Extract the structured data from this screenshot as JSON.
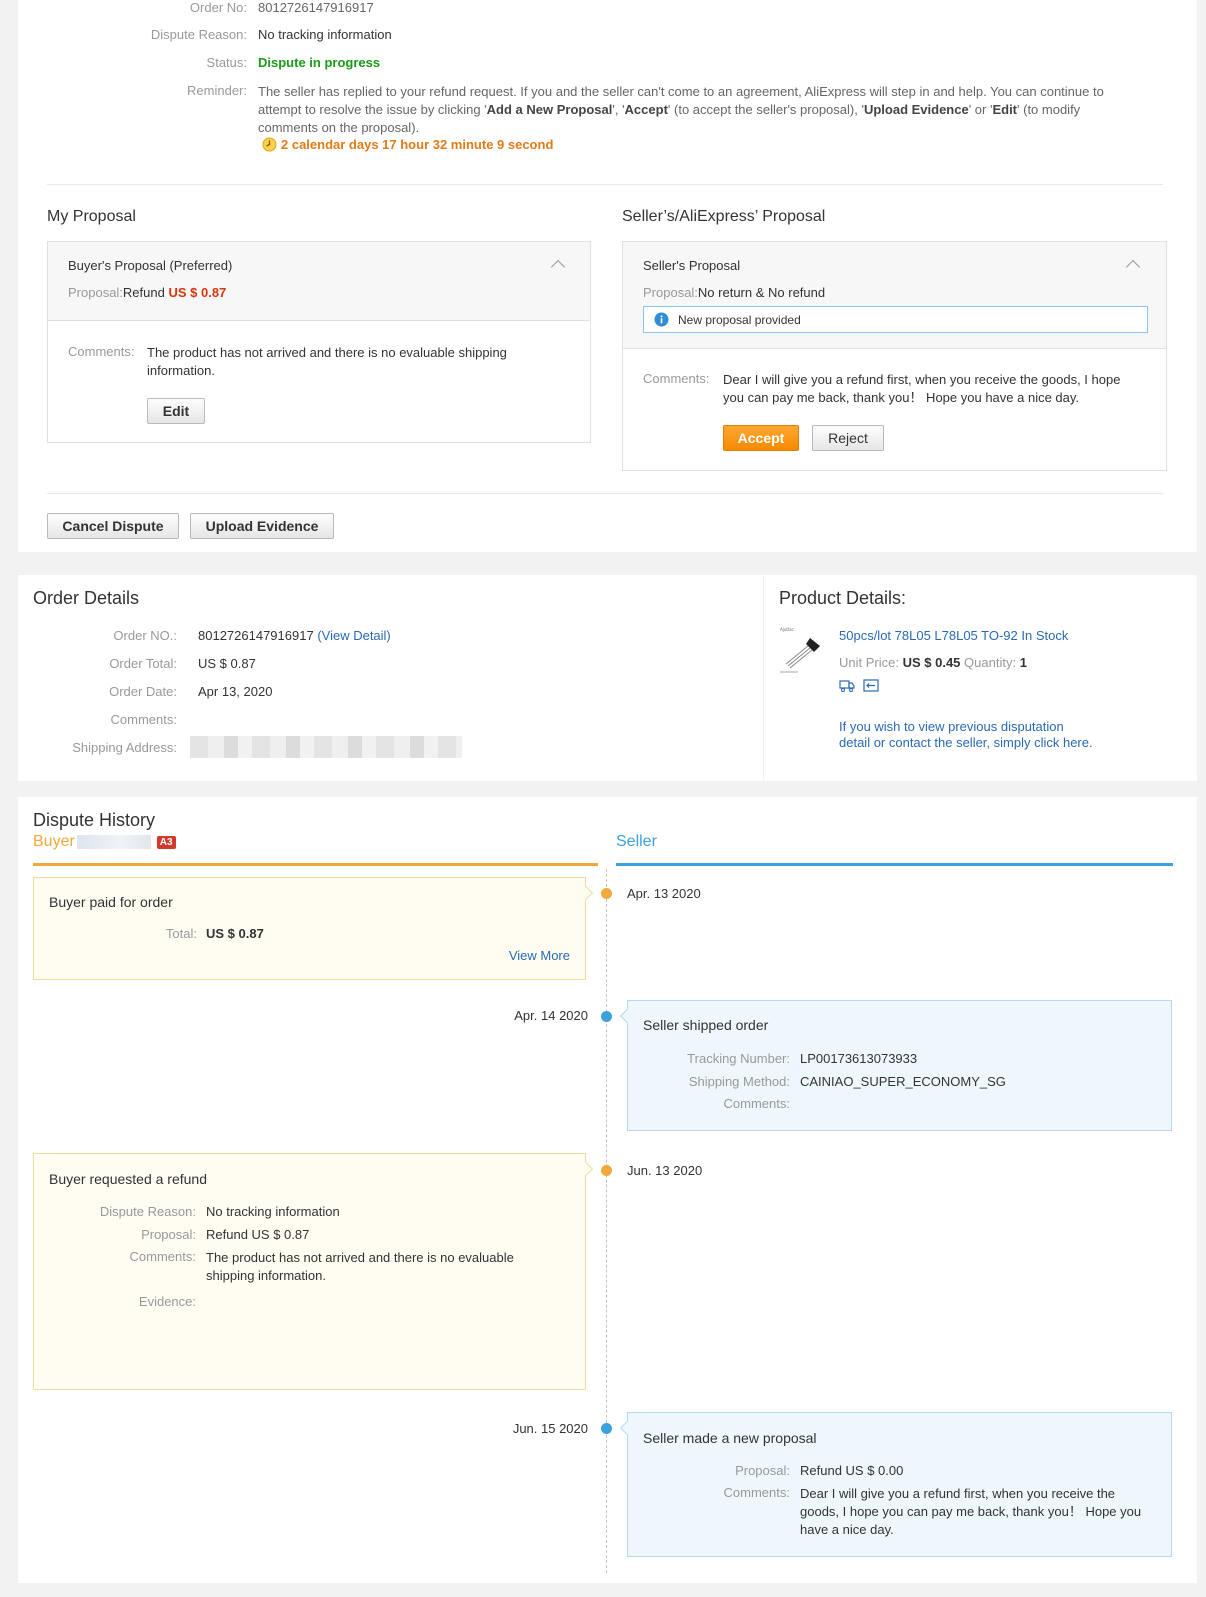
{
  "dispute": {
    "order_no_label": "Order No:",
    "order_no": "8012726147916917",
    "reason_label": "Dispute Reason:",
    "reason": "No tracking information",
    "status_label": "Status:",
    "status": "Dispute in progress",
    "reminder_label": "Reminder:",
    "reminder_text_1": "The seller has replied to your refund request. If you and the seller can't come to an agreement, AliExpress will step in and help. You can continue to",
    "reminder_text_2a": "attempt to resolve the issue by clicking '",
    "reminder_add": "Add a New Proposal",
    "reminder_text_2b": "', '",
    "reminder_accept": "Accept",
    "reminder_text_2c": "' (to accept the seller's proposal), '",
    "reminder_upload": "Upload Evidence",
    "reminder_text_2d": "' or '",
    "reminder_edit": "Edit",
    "reminder_text_2e": "' (to modify",
    "reminder_text_3": "comments on the proposal).",
    "countdown": "2 calendar days 17 hour 32 minute 9 second"
  },
  "my_proposal": {
    "heading": "My Proposal",
    "title": "Buyer's Proposal (Preferred)",
    "proposal_label": "Proposal:",
    "proposal_text": "Refund ",
    "proposal_amount": "US $ 0.87",
    "comments_label": "Comments:",
    "comments_1": "The product has not arrived and there is no evaluable shipping",
    "comments_2": "information.",
    "edit_label": "Edit"
  },
  "seller_proposal": {
    "heading": "Seller’s/AliExpress’ Proposal",
    "title": "Seller's Proposal",
    "proposal_label": "Proposal:",
    "proposal_text": "No return & No refund",
    "notice": "New proposal provided",
    "comments_label": "Comments:",
    "comments_1": "Dear I will give you a refund first, when you receive the goods, I hope",
    "comments_2": "you can pay me back, thank you！ Hope you have a nice day.",
    "accept_label": "Accept",
    "reject_label": "Reject"
  },
  "actions": {
    "cancel_label": "Cancel Dispute",
    "upload_label": "Upload Evidence"
  },
  "order_details": {
    "heading": "Order Details",
    "order_no_label": "Order NO.:",
    "order_no": "8012726147916917",
    "view_detail": "(View Detail)",
    "total_label": "Order Total:",
    "total": "US $ 0.87",
    "date_label": "Order Date:",
    "date": "Apr 13, 2020",
    "comments_label": "Comments:",
    "address_label": "Shipping Address:"
  },
  "product_details": {
    "heading": "Product Details:",
    "name": "50pcs/lot 78L05 L78L05 TO-92 In Stock",
    "unit_price_label": "Unit Price:",
    "unit_price": "US $ 0.45",
    "quantity_label": "Quantity:",
    "quantity": "1",
    "previous_link_1": "If you wish to view previous disputation",
    "previous_link_2": "detail or contact the seller, simply click here."
  },
  "history": {
    "heading": "Dispute History",
    "buyer_label": "Buyer",
    "buyer_badge": "A3",
    "seller_label": "Seller",
    "events": {
      "e1": {
        "date": "Apr. 13 2020",
        "title": "Buyer paid for order",
        "total_label": "Total:",
        "total": "US $ 0.87",
        "view_more": "View More"
      },
      "e2": {
        "date": "Apr. 14 2020",
        "title": "Seller shipped order",
        "tracking_label": "Tracking Number:",
        "tracking": "LP00173613073933",
        "method_label": "Shipping Method:",
        "method": "CAINIAO_SUPER_ECONOMY_SG",
        "comments_label": "Comments:"
      },
      "e3": {
        "date": "Jun. 13 2020",
        "title": "Buyer requested a refund",
        "reason_label": "Dispute Reason:",
        "reason": "No tracking information",
        "proposal_label": "Proposal:",
        "proposal": "Refund US $ 0.87",
        "comments_label": "Comments:",
        "comments_1": "The product has not arrived and there is no evaluable",
        "comments_2": "shipping information.",
        "evidence_label": "Evidence:"
      },
      "e4": {
        "date": "Jun. 15 2020",
        "title": "Seller made a new proposal",
        "proposal_label": "Proposal:",
        "proposal": "Refund US $ 0.00",
        "comments_label": "Comments:",
        "comments_1": "Dear I will give you a refund first, when you receive the",
        "comments_2": "goods, I hope you can pay me back, thank you！ Hope you",
        "comments_3": "have a nice day."
      }
    }
  },
  "colors": {
    "status_green": "#1a9a17",
    "countdown_orange": "#e07b17",
    "price_red": "#d9360b",
    "link_blue": "#2a6ab3",
    "buyer_orange": "#f0a93a",
    "seller_blue": "#3aa1de",
    "accept_orange": "#f48a00"
  }
}
